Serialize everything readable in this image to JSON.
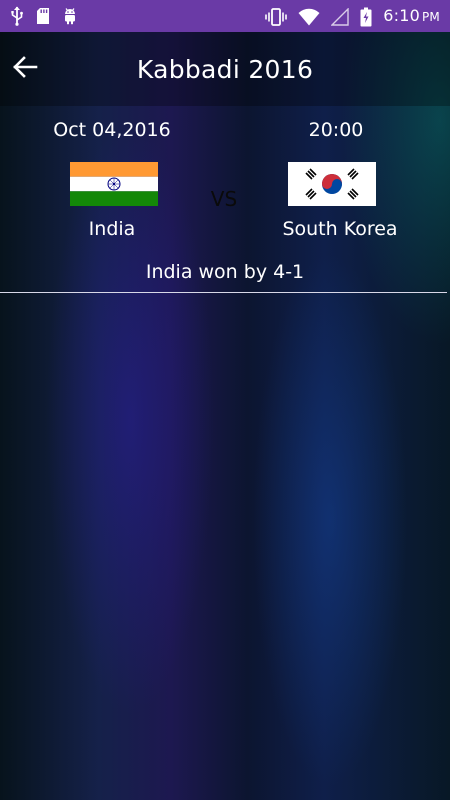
{
  "status_bar": {
    "time": "6:10",
    "ampm": "PM",
    "left_icons": [
      "usb-icon",
      "sd-card-icon",
      "android-debug-icon"
    ],
    "right_icons": [
      "vibrate-icon",
      "wifi-icon",
      "signal-icon",
      "battery-charging-icon"
    ],
    "background_color": "#6a3aa6"
  },
  "app_bar": {
    "title": "Kabbadi 2016",
    "back_icon": "arrow-left-icon"
  },
  "match": {
    "date": "Oct 04,2016",
    "time": "20:00",
    "vs_label": "VS",
    "team_left": {
      "name": "India",
      "flag_icon": "india-flag-icon"
    },
    "team_right": {
      "name": "South Korea",
      "flag_icon": "south-korea-flag-icon"
    },
    "result": "India won by 4-1"
  }
}
